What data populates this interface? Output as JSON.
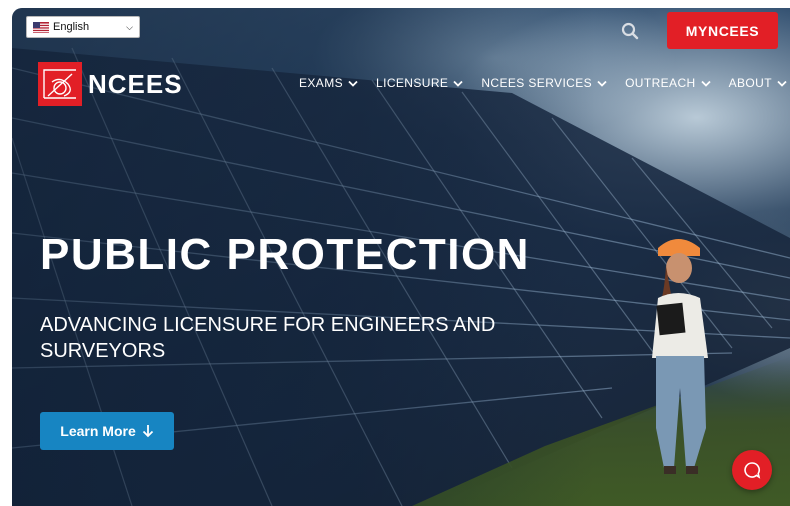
{
  "language": {
    "selected": "English"
  },
  "header": {
    "myncees_label": "MYNCEES",
    "logo_text": "NCEES"
  },
  "nav": {
    "items": [
      {
        "label": "EXAMS"
      },
      {
        "label": "LICENSURE"
      },
      {
        "label": "NCEES SERVICES"
      },
      {
        "label": "OUTREACH"
      },
      {
        "label": "ABOUT"
      }
    ]
  },
  "hero": {
    "headline": "PUBLIC PROTECTION",
    "subhead": "ADVANCING LICENSURE FOR ENGINEERS AND SURVEYORS",
    "cta_label": "Learn More"
  },
  "colors": {
    "brand_red": "#e21f26",
    "cta_blue": "#1785c2"
  },
  "icons": [
    "us-flag-icon",
    "chevron-down-icon",
    "search-icon",
    "ncees-logo-icon",
    "arrow-down-icon",
    "chat-icon"
  ]
}
